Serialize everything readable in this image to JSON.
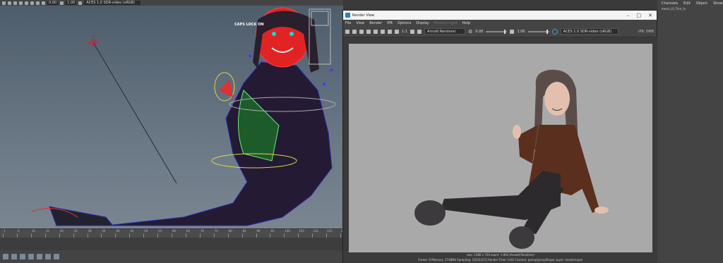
{
  "toolbar": {
    "val1": "0.00",
    "val2": "1.00",
    "colorspace": "ACES 1.0 SDR-video (sRGB)"
  },
  "viewport": {
    "caps_lock": "CAPS LOCK ON",
    "camera": "persp"
  },
  "timeline": {
    "ticks": [
      "1",
      "5",
      "10",
      "15",
      "20",
      "25",
      "30",
      "35",
      "40",
      "45",
      "50",
      "55",
      "60",
      "65",
      "70",
      "75",
      "80",
      "85",
      "90",
      "95",
      "100",
      "105",
      "110",
      "115",
      "120"
    ]
  },
  "render_view": {
    "title": "Render View",
    "menu": [
      "File",
      "View",
      "Render",
      "IPR",
      "Options",
      "Display",
      "Product Lgpd",
      "Help"
    ],
    "ratio": "1:1",
    "renderer": "Arnold Renderer",
    "exposure": "0.00",
    "gamma": "1.00",
    "colorspace": "ACES 1.0 SDR-video (sRGB)",
    "ipr": "IPR: 0MB",
    "status_line1": "size: 1280 x 720  zoom: 1.003   (Arnold Renderer)",
    "status_line2": "Frame: 0   Memory: 2748Mb   Sampling: [3/2/2/2/2]   Render Time: 0:02   Camera: |persp|perspShape   Layer: masterLayer"
  },
  "channel_box": {
    "menu": [
      "Channels",
      "Edit",
      "Object",
      "Show"
    ],
    "subtitle": "mesh_L0_Trim_tv"
  }
}
